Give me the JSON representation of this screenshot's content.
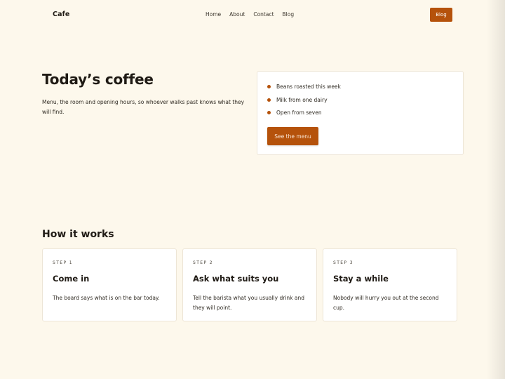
{
  "header": {
    "brand": "Cafe",
    "nav": [
      "Home",
      "About",
      "Contact",
      "Blog"
    ],
    "cta_label": "Blog"
  },
  "hero": {
    "title": "Today’s coffee",
    "description": "Menu, the room and opening hours, so whoever walks past knows what they will find.",
    "features": [
      "Beans roasted this week",
      "Milk from one dairy",
      "Open from seven"
    ],
    "button_label": "See the menu"
  },
  "how": {
    "title": "How it works",
    "steps": [
      {
        "kicker": "STEP 1",
        "title": "Come in",
        "text": "The board says what is on the bar today."
      },
      {
        "kicker": "STEP 2",
        "title": "Ask what suits you",
        "text": "Tell the barista what you usually drink and they will point."
      },
      {
        "kicker": "STEP 3",
        "title": "Stay a while",
        "text": "Nobody will hurry you out at the second cup."
      }
    ]
  },
  "colors": {
    "background": "#fdf8ec",
    "accent": "#b5520b",
    "card": "#ffffff",
    "text": "#1f1a14"
  },
  "icons": {
    "feature_bullet": "dot-icon"
  }
}
